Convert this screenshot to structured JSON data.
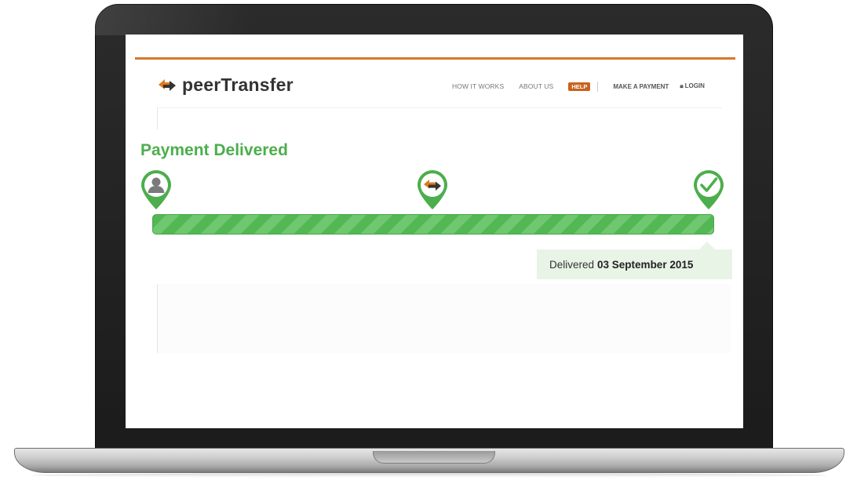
{
  "brand": {
    "name": "peerTransfer",
    "logo_icon": "handshake-arrows-icon"
  },
  "nav": {
    "how_it_works": "HOW IT WORKS",
    "about_us": "ABOUT US",
    "help": "HELP",
    "make_payment": "MAKE A PAYMENT",
    "login": "LOGIN"
  },
  "status": {
    "title": "Payment Delivered",
    "progress_percent": 100,
    "steps": [
      {
        "icon": "user-icon"
      },
      {
        "icon": "handshake-arrows-icon"
      },
      {
        "icon": "checkmark-icon"
      }
    ],
    "delivered_label": "Delivered",
    "delivered_date": "03 September 2015"
  },
  "colors": {
    "accent_orange": "#d8772a",
    "success_green": "#4cae4c",
    "stripe_light": "#6fc86f",
    "stripe_dark": "#53b753",
    "help_badge": "#c9621e"
  }
}
